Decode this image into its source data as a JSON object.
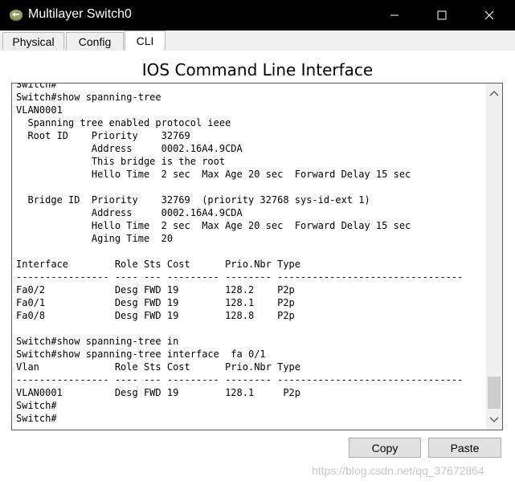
{
  "window": {
    "title": "Multilayer Switch0",
    "minimize_icon": "minimize-icon",
    "maximize_icon": "maximize-icon",
    "close_icon": "close-icon"
  },
  "tabs": [
    {
      "label": "Physical"
    },
    {
      "label": "Config"
    },
    {
      "label": "CLI",
      "active": true
    }
  ],
  "panel": {
    "heading": "IOS Command Line Interface"
  },
  "console": {
    "lines": [
      "Switch#",
      "Switch#show spanning-tree",
      "VLAN0001",
      "  Spanning tree enabled protocol ieee",
      "  Root ID    Priority    32769",
      "             Address     0002.16A4.9CDA",
      "             This bridge is the root",
      "             Hello Time  2 sec  Max Age 20 sec  Forward Delay 15 sec",
      "",
      "  Bridge ID  Priority    32769  (priority 32768 sys-id-ext 1)",
      "             Address     0002.16A4.9CDA",
      "             Hello Time  2 sec  Max Age 20 sec  Forward Delay 15 sec",
      "             Aging Time  20",
      "",
      "Interface        Role Sts Cost      Prio.Nbr Type",
      "---------------- ---- --- --------- -------- --------------------------------",
      "Fa0/2            Desg FWD 19        128.2    P2p",
      "Fa0/1            Desg FWD 19        128.1    P2p",
      "Fa0/8            Desg FWD 19        128.8    P2p",
      "",
      "Switch#show spanning-tree in",
      "Switch#show spanning-tree interface  fa 0/1",
      "Vlan             Role Sts Cost      Prio.Nbr Type",
      "---------------- ---- --- --------- -------- --------------------------------",
      "VLAN0001         Desg FWD 19        128.1     P2p",
      "Switch#",
      "Switch#"
    ]
  },
  "buttons": {
    "copy": "Copy",
    "paste": "Paste"
  },
  "watermark": "https://blog.csdn.net/qq_37672864",
  "colors": {
    "titlebar": "#000000",
    "background": "#f0f0f0",
    "panel": "#ffffff"
  }
}
